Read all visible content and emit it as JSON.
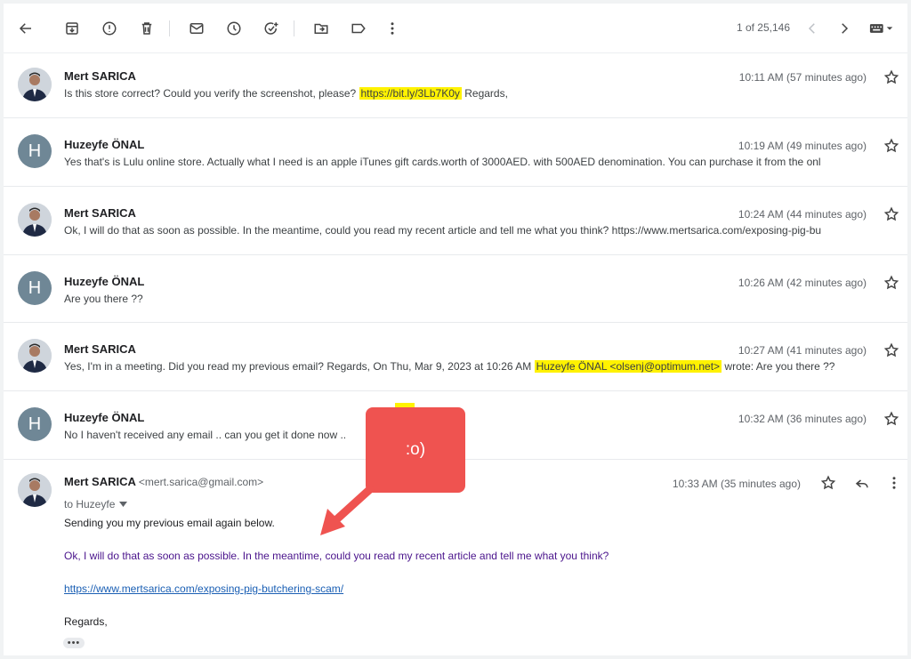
{
  "toolbar": {
    "icons": [
      "back-arrow-icon",
      "archive-icon",
      "report-spam-icon",
      "delete-icon",
      "mark-unread-icon",
      "snooze-icon",
      "add-task-icon",
      "move-to-icon",
      "label-icon",
      "more-vertical-icon"
    ],
    "page_count": "1 of 25,146"
  },
  "thread": [
    {
      "sender": "Mert SARICA",
      "avatar": "photo",
      "time": "10:11 AM (57 minutes ago)",
      "snippet_before": "Is this store correct? Could you verify the screenshot, please? ",
      "snippet_highlight": "https://bit.ly/3Lb7K0y",
      "snippet_after": " Regards,"
    },
    {
      "sender": "Huzeyfe ÖNAL",
      "avatar": "H",
      "time": "10:19 AM (49 minutes ago)",
      "snippet": "Yes that's is Lulu online store. Actually what I need is an apple iTunes gift cards.worth of 3000AED. with 500AED denomination. You can purchase it from the onl"
    },
    {
      "sender": "Mert SARICA",
      "avatar": "photo",
      "time": "10:24 AM (44 minutes ago)",
      "snippet": "Ok, I will do that as soon as possible. In the meantime, could you read my recent article and tell me what you think? https://www.mertsarica.com/exposing-pig-bu"
    },
    {
      "sender": "Huzeyfe ÖNAL",
      "avatar": "H",
      "time": "10:26 AM (42 minutes ago)",
      "snippet": "Are you there ??"
    },
    {
      "sender": "Mert SARICA",
      "avatar": "photo",
      "time": "10:27 AM (41 minutes ago)",
      "snippet_before": "Yes, I'm in a meeting. Did you read my previous email? Regards, On Thu, Mar 9, 2023 at 10:26 AM ",
      "snippet_highlight": "Huzeyfe ÖNAL <olsenj@optimum.net>",
      "snippet_after": " wrote: Are you there ??"
    },
    {
      "sender": "Huzeyfe ÖNAL",
      "avatar": "H",
      "time": "10:32 AM (36 minutes ago)",
      "snippet": "No I haven't received any email .. can you get it done now .."
    }
  ],
  "expanded": {
    "sender": "Mert SARICA",
    "email": "<mert.sarica@gmail.com>",
    "time": "10:33 AM (35 minutes ago)",
    "to": "to Huzeyfe",
    "body_intro": "Sending you my previous email again below.",
    "body_quote": "Ok, I will do that as soon as possible. In the meantime, could you read my recent article and tell me what you think?",
    "body_link": "https://www.mertsarica.com/exposing-pig-butchering-scam/",
    "body_sign": "Regards,",
    "dots": "•••"
  },
  "annotation": {
    "text": ":o)",
    "color": "#ef5350"
  },
  "colors": {
    "highlight": "#fff200",
    "link": "#1a5fb4",
    "quote": "#4a148c",
    "avatar_letter_bg": "#6f8796"
  }
}
